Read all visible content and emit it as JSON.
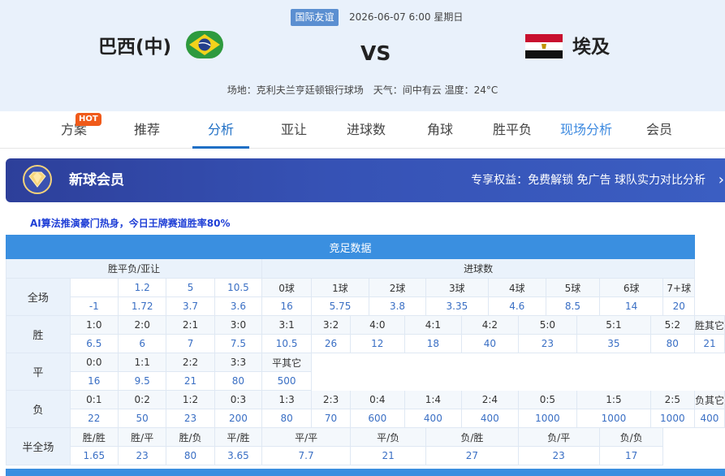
{
  "header": {
    "league": "国际友谊",
    "datetime": "2026-06-07 6:00 星期日",
    "home_team": "巴西(中)",
    "vs": "VS",
    "away_team": "埃及",
    "venue_text": "场地：克利夫兰亨廷顿银行球场　天气：间中有云 温度：24°C"
  },
  "tabs": [
    "方案",
    "推荐",
    "分析",
    "亚让",
    "进球数",
    "角球",
    "胜平负",
    "现场分析",
    "会员"
  ],
  "hot_badge": "HOT",
  "member": {
    "title": "新球会员",
    "perks": "专享权益：免费解锁 免广告 球队实力对比分析",
    "arrow": "›"
  },
  "promo": "AI算法推演豪门热身，今日王牌赛道胜率80%",
  "table": {
    "title": "竞足数据",
    "group1": "胜平负/亚让",
    "group2": "进球数",
    "full_label": "全场",
    "full_handicap_row": [
      "",
      "1.2",
      "5",
      "10.5"
    ],
    "full_odds_row": [
      "-1",
      "1.72",
      "3.7",
      "3.6"
    ],
    "goal_keys": [
      "0球",
      "1球",
      "2球",
      "3球",
      "4球",
      "5球",
      "6球",
      "7+球"
    ],
    "goal_vals": [
      "16",
      "5.75",
      "3.8",
      "3.35",
      "4.6",
      "8.5",
      "14",
      "20"
    ],
    "win_label": "胜",
    "win_keys": [
      "1:0",
      "2:0",
      "2:1",
      "3:0",
      "3:1",
      "3:2",
      "4:0",
      "4:1",
      "4:2",
      "5:0",
      "5:1",
      "5:2",
      "胜其它"
    ],
    "win_vals": [
      "6.5",
      "6",
      "7",
      "7.5",
      "10.5",
      "26",
      "12",
      "18",
      "40",
      "23",
      "35",
      "80",
      "21"
    ],
    "draw_label": "平",
    "draw_keys": [
      "0:0",
      "1:1",
      "2:2",
      "3:3",
      "平其它"
    ],
    "draw_vals": [
      "16",
      "9.5",
      "21",
      "80",
      "500"
    ],
    "loss_label": "负",
    "loss_keys": [
      "0:1",
      "0:2",
      "1:2",
      "0:3",
      "1:3",
      "2:3",
      "0:4",
      "1:4",
      "2:4",
      "0:5",
      "1:5",
      "2:5",
      "负其它"
    ],
    "loss_vals": [
      "22",
      "50",
      "23",
      "200",
      "80",
      "70",
      "600",
      "400",
      "400",
      "1000",
      "1000",
      "1000",
      "400"
    ],
    "half_label": "半全场",
    "half_keys": [
      "胜/胜",
      "胜/平",
      "胜/负",
      "平/胜",
      "平/平",
      "平/负",
      "负/胜",
      "负/平",
      "负/负"
    ],
    "half_vals": [
      "1.65",
      "23",
      "80",
      "3.65",
      "7.7",
      "21",
      "27",
      "23",
      "17"
    ]
  },
  "colors": {
    "accent": "#1f6fc5",
    "table_header": "#3a8fe0",
    "value_text": "#3a6fc4",
    "promo_text": "#1f3fd6",
    "hot": "#f05a1a"
  }
}
